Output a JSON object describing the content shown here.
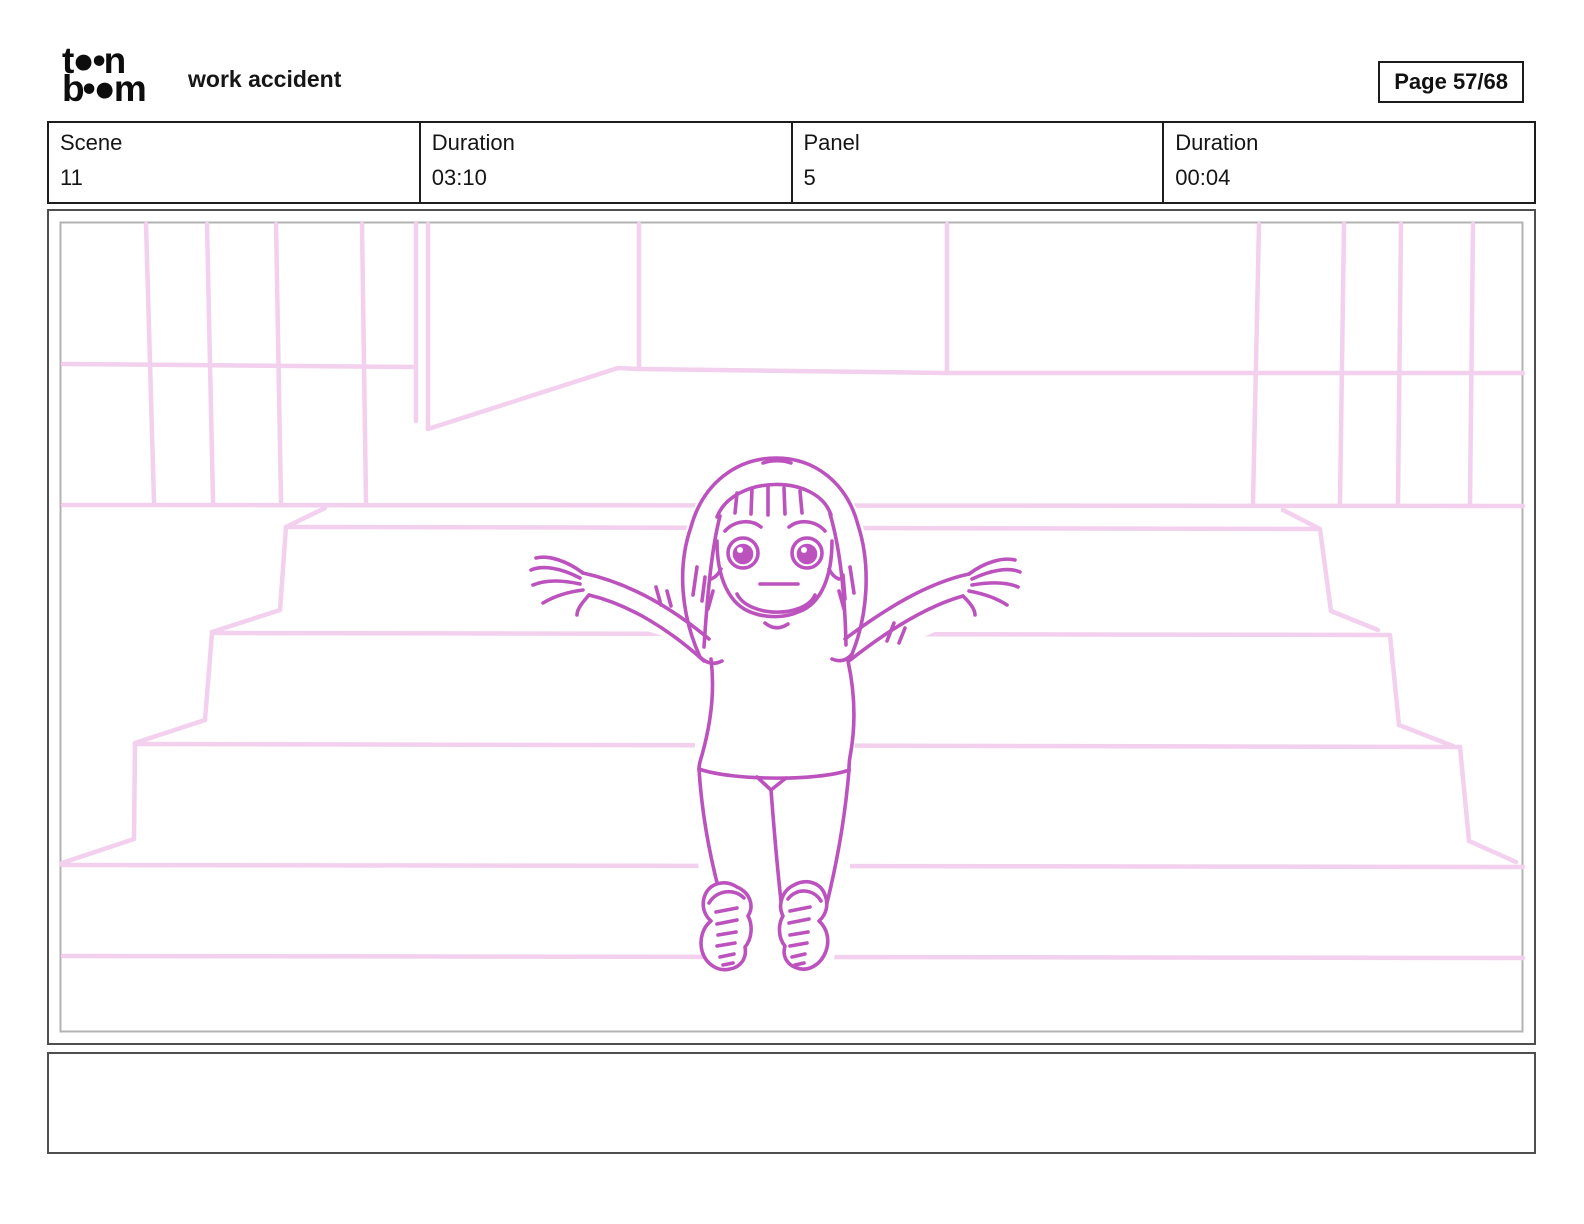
{
  "header": {
    "logo_line1": "t●•n",
    "logo_line2": "b•●m",
    "title": "work accident",
    "page_label": "Page 57/68"
  },
  "table": {
    "cells": [
      {
        "label": "Scene",
        "value": "11"
      },
      {
        "label": "Duration",
        "value": "03:10"
      },
      {
        "label": "Panel",
        "value": "5"
      },
      {
        "label": "Duration",
        "value": "00:04"
      }
    ]
  },
  "panel": {
    "description": "storyboard sketch: girl sitting on staircase, arms spread, worried expression",
    "figure_line_color": "#bc52be",
    "background_line_color": "#f2d0ee"
  },
  "caption": {
    "text": ""
  }
}
